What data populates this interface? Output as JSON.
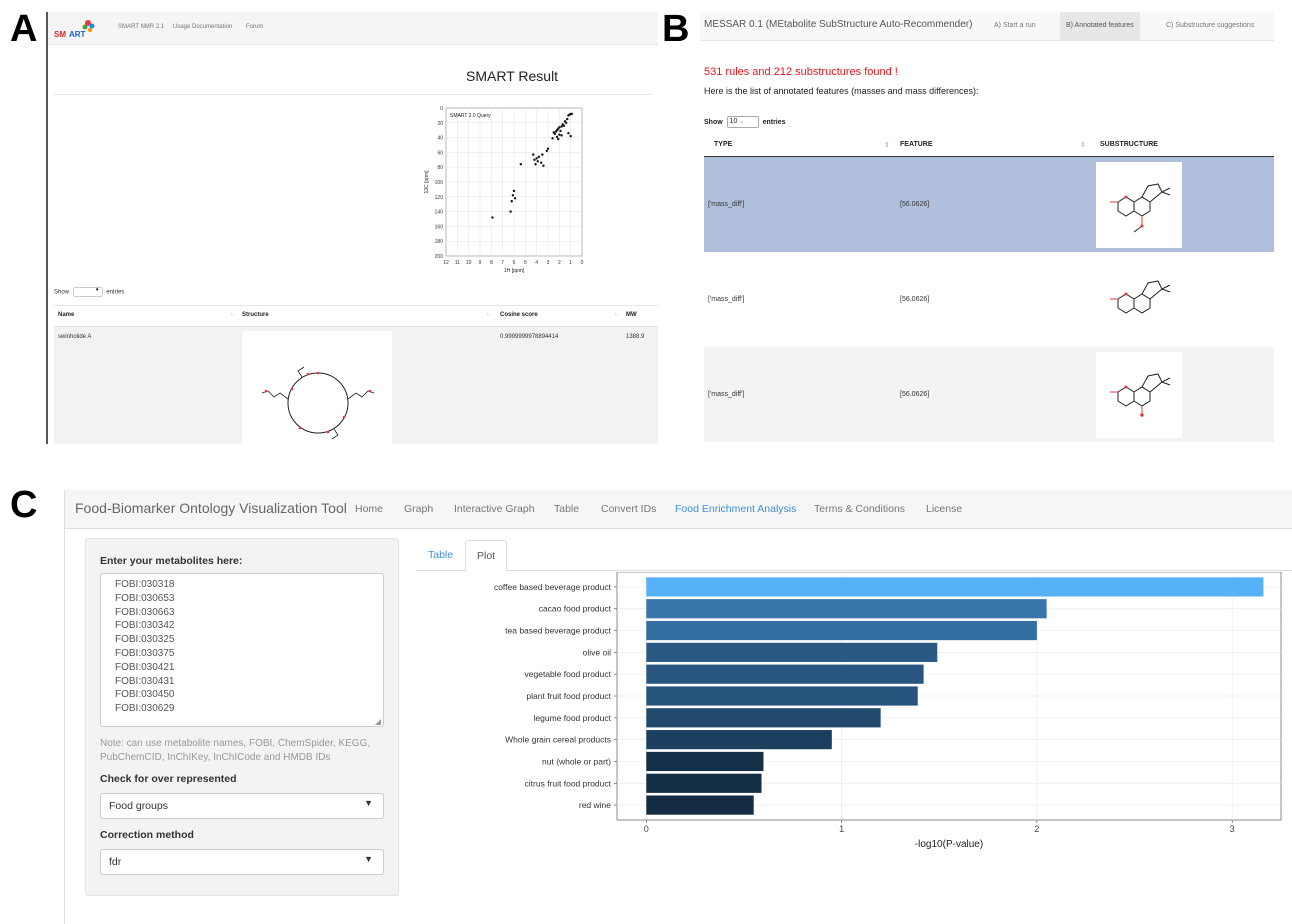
{
  "labels": {
    "a": "A",
    "b": "B",
    "c": "C"
  },
  "panel_a": {
    "nav": {
      "version": "SMART NMR 2.1",
      "docs": "Usage Documentation",
      "forum": "Forum"
    },
    "title": "SMART Result",
    "plot": {
      "legend": "SMART 2.0 Query",
      "xlabel": "1H [ppm]",
      "ylabel": "13C [ppm]",
      "x_ticks": [
        "12",
        "11",
        "10",
        "9",
        "8",
        "7",
        "6",
        "5",
        "4",
        "3",
        "2",
        "1",
        "0"
      ],
      "y_ticks": [
        "0",
        "20",
        "40",
        "60",
        "80",
        "100",
        "120",
        "140",
        "160",
        "180",
        "200"
      ],
      "points": [
        [
          1.0,
          8
        ],
        [
          1.1,
          9
        ],
        [
          1.2,
          10
        ],
        [
          0.9,
          8
        ],
        [
          1.3,
          15
        ],
        [
          1.5,
          18
        ],
        [
          1.4,
          20
        ],
        [
          1.7,
          22
        ],
        [
          1.6,
          24
        ],
        [
          1.8,
          25
        ],
        [
          2.0,
          26
        ],
        [
          2.1,
          28
        ],
        [
          2.2,
          30
        ],
        [
          1.9,
          31
        ],
        [
          2.3,
          32
        ],
        [
          2.5,
          33
        ],
        [
          2.4,
          35
        ],
        [
          2.0,
          36
        ],
        [
          1.8,
          37
        ],
        [
          2.2,
          39
        ],
        [
          2.6,
          41
        ],
        [
          2.1,
          42
        ],
        [
          1.0,
          38
        ],
        [
          1.2,
          34
        ],
        [
          3.0,
          55
        ],
        [
          3.1,
          58
        ],
        [
          3.5,
          63
        ],
        [
          3.8,
          66
        ],
        [
          4.0,
          68
        ],
        [
          4.2,
          70
        ],
        [
          3.9,
          72
        ],
        [
          3.6,
          74
        ],
        [
          4.1,
          76
        ],
        [
          3.4,
          78
        ],
        [
          5.4,
          76
        ],
        [
          4.3,
          63
        ],
        [
          6.0,
          112
        ],
        [
          6.1,
          118
        ],
        [
          5.9,
          122
        ],
        [
          6.2,
          126
        ],
        [
          6.3,
          140
        ],
        [
          7.9,
          148
        ]
      ]
    },
    "show_label": "Show",
    "entries_label": "entries",
    "table": {
      "headers": [
        "Name",
        "Structure",
        "Cosine score",
        "MW"
      ],
      "row": {
        "name": "swinholide A",
        "score": "0.9999999978894414",
        "mw": "1388.9"
      }
    }
  },
  "panel_b": {
    "brand": "MESSAR 0.1 (MEtabolite SubStructure Auto-Recommender)",
    "tabs": [
      "A) Start a run",
      "B) Annotated features",
      "C) Substructure suggestions"
    ],
    "active_tab": 1,
    "found": "531 rules and 212 substructures found !",
    "list_text": "Here is the list of annotated features (masses and mass differences):",
    "show_label": "Show",
    "page_size": "10",
    "entries_label": "entries",
    "headers": [
      "TYPE",
      "FEATURE",
      "SUBSTRUCTURE"
    ],
    "rows": [
      {
        "type": "['mass_diff']",
        "feature": "[56.0626]"
      },
      {
        "type": "['mass_diff']",
        "feature": "[56.0626]"
      },
      {
        "type": "['mass_diff']",
        "feature": "[56.0626]"
      }
    ]
  },
  "panel_c": {
    "brand": "Food-Biomarker Ontology Visualization Tool",
    "nav": [
      "Home",
      "Graph",
      "Interactive Graph",
      "Table",
      "Convert IDs",
      "Food Enrichment Analysis",
      "Terms & Conditions",
      "License"
    ],
    "active_nav": "Food Enrichment Analysis",
    "sidebar": {
      "metabolites_label": "Enter your metabolites here:",
      "metabolites": [
        "FOBI:030318",
        "FOBI:030653",
        "FOBI:030663",
        "FOBI:030342",
        "FOBI:030325",
        "FOBI:030375",
        "FOBI:030421",
        "FOBI:030431",
        "FOBI:030450",
        "FOBI:030629"
      ],
      "note": "Note: can use metabolite names, FOBI, ChemSpider, KEGG, PubChemCID, InChIKey, InChICode and HMDB IDs",
      "check_label": "Check for over represented",
      "check_value": "Food groups",
      "correction_label": "Correction method",
      "correction_value": "fdr"
    },
    "tabs": [
      "Table",
      "Plot"
    ],
    "active_tab": "Plot"
  },
  "chart_data": {
    "type": "bar",
    "orientation": "horizontal",
    "categories": [
      "coffee based beverage product",
      "cacao food product",
      "tea based beverage product",
      "olive oil",
      "vegetable food product",
      "plant fruit food product",
      "legume food product",
      "Whole grain cereal products",
      "nut (whole or part)",
      "citrus fruit food product",
      "red wine"
    ],
    "values": [
      3.16,
      2.05,
      2.0,
      1.49,
      1.42,
      1.39,
      1.2,
      0.95,
      0.6,
      0.59,
      0.55
    ],
    "xlabel": "-log10(P-value)",
    "ylabel": "",
    "xlim": [
      -0.15,
      3.25
    ],
    "x_ticks": [
      0,
      1,
      2,
      3
    ],
    "grid": true,
    "colors": [
      "#56b1f7",
      "#3775aa",
      "#336ea0",
      "#2a5a84",
      "#285680",
      "#27547c",
      "#214a6e",
      "#1c3f60",
      "#152f48",
      "#142e46",
      "#132b43"
    ]
  }
}
